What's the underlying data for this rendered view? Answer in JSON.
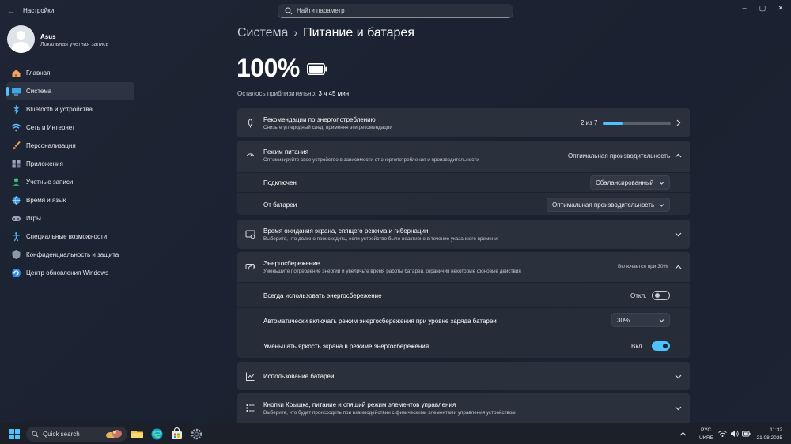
{
  "window": {
    "app_title": "Настройки",
    "search_placeholder": "Найти параметр",
    "controls": {
      "minimize": "–",
      "maximize": "▢",
      "close": "✕"
    }
  },
  "profile": {
    "name": "Asus",
    "account_type": "Локальная учетная запись"
  },
  "sidebar": {
    "items": [
      {
        "label": "Главная",
        "icon": "home-icon"
      },
      {
        "label": "Система",
        "icon": "system-icon",
        "active": true
      },
      {
        "label": "Bluetooth и устройства",
        "icon": "bluetooth-icon"
      },
      {
        "label": "Сеть и Интернет",
        "icon": "wifi-icon"
      },
      {
        "label": "Персонализация",
        "icon": "brush-icon"
      },
      {
        "label": "Приложения",
        "icon": "apps-icon"
      },
      {
        "label": "Учетные записи",
        "icon": "user-icon"
      },
      {
        "label": "Время и язык",
        "icon": "globe-icon"
      },
      {
        "label": "Игры",
        "icon": "gamepad-icon"
      },
      {
        "label": "Специальные возможности",
        "icon": "accessibility-icon"
      },
      {
        "label": "Конфиденциальность и защита",
        "icon": "shield-icon"
      },
      {
        "label": "Центр обновления Windows",
        "icon": "update-icon"
      }
    ]
  },
  "main": {
    "breadcrumb_parent": "Система",
    "breadcrumb_separator": "›",
    "breadcrumb_current": "Питание и батарея",
    "battery_percent": "100%",
    "battery_level": 1.0,
    "remaining_label": "Осталось приблизительно:",
    "remaining_value": "3 ч 45 мин",
    "recommendations": {
      "title": "Рекомендации по энергопотреблению",
      "subtitle": "Снизьте углеродный след, применяя эти рекомендации",
      "progress_text": "2 из 7",
      "progress_fraction": 0.2857
    },
    "power_mode": {
      "title": "Режим питания",
      "subtitle": "Оптимизируйте свое устройство в зависимости от энергопотребления и производительности",
      "value": "Оптимальная производительность",
      "plugged_label": "Подключен",
      "plugged_value": "Сбалансированный",
      "battery_label": "От батареи",
      "battery_value": "Оптимальная производительность"
    },
    "screen_sleep": {
      "title": "Время ожидания экрана, спящего режима и гибернации",
      "subtitle": "Выберите, что должно происходить, если устройство было неактивно в течение указанного времени"
    },
    "energy_saver": {
      "title": "Энергосбережение",
      "subtitle": "Уменьшите потребление энергии и увеличьте время работы батареи, ограничив некоторые фоновые действия",
      "status": "Включается при 30%",
      "always_label": "Всегда использовать энергосбережение",
      "always_state": "Откл.",
      "auto_label": "Автоматически включать режим энергосбережения при уровне заряда батареи",
      "auto_value": "30%",
      "brightness_label": "Уменьшать яркость экрана в режиме энергосбережения",
      "brightness_state": "Вкл."
    },
    "battery_usage": {
      "title": "Использование батареи"
    },
    "lid_buttons": {
      "title": "Кнопки Крышка, питание и спящий режим элементов управления",
      "subtitle": "Выберите, что будет происходить при взаимодействии с физическими элементами управления устройством"
    }
  },
  "taskbar": {
    "search_text": "Quick search",
    "lang_line1": "РУС",
    "lang_line2": "UKRE",
    "time": "11:32",
    "date": "21.08.2025"
  },
  "colors": {
    "accent": "#4cc2ff",
    "card": "#2a303c",
    "background": "#1b2230"
  }
}
